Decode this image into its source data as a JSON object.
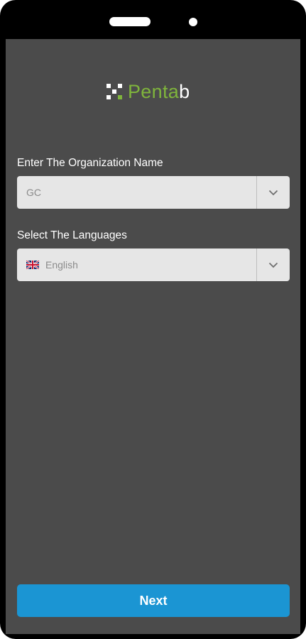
{
  "logo": {
    "brand_main": "Penta",
    "brand_suffix": "b",
    "accent_color": "#7fb43c"
  },
  "organization": {
    "label": "Enter The Organization Name",
    "selected": "GC",
    "dropdown_icon": "chevron-down-icon"
  },
  "language": {
    "label": "Select The Languages",
    "selected": "English",
    "flag_icon": "uk-flag-icon",
    "dropdown_icon": "chevron-down-icon"
  },
  "actions": {
    "next_label": "Next",
    "button_color": "#1b95d3"
  }
}
